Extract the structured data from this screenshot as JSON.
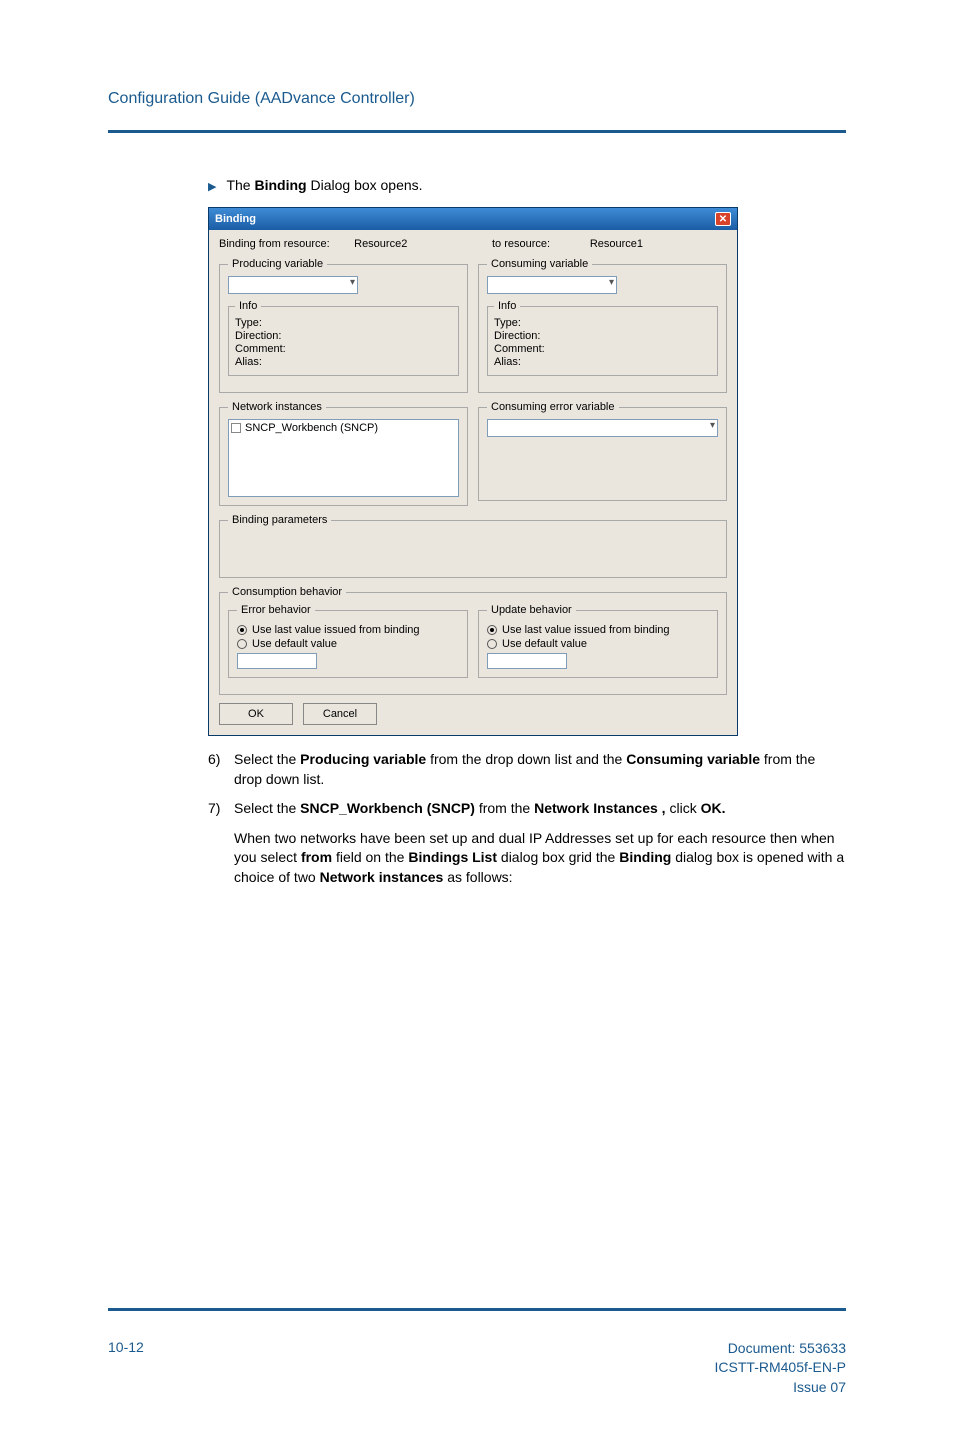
{
  "header": {
    "title": "Configuration Guide (AADvance Controller)"
  },
  "bullet": {
    "prefix": "The ",
    "bold": "Binding",
    "suffix": "  Dialog box opens."
  },
  "dialog": {
    "title": "Binding",
    "top": {
      "fromLabel": "Binding from resource:",
      "fromVal": "Resource2",
      "toLabel": "to resource:",
      "toVal": "Resource1"
    },
    "left": {
      "prodVar": "Producing variable",
      "info": "Info",
      "type": "Type:",
      "direction": "Direction:",
      "comment": "Comment:",
      "alias": "Alias:",
      "netInst": "Network instances",
      "treeItem": "SNCP_Workbench (SNCP)"
    },
    "right": {
      "consVar": "Consuming variable",
      "info": "Info",
      "type": "Type:",
      "direction": "Direction:",
      "comment": "Comment:",
      "alias": "Alias:",
      "consErr": "Consuming error variable"
    },
    "params": "Binding parameters",
    "consumption": {
      "legend": "Consumption behavior",
      "error": {
        "legend": "Error behavior",
        "r1": "Use last value issued from binding",
        "r2": "Use default value"
      },
      "update": {
        "legend": "Update behavior",
        "r1": "Use last value issued from binding",
        "r2": "Use default value"
      }
    },
    "ok": "OK",
    "cancel": "Cancel"
  },
  "steps": {
    "s6": {
      "a": "Select the ",
      "b": "Producing variable",
      "c": " from the drop down list and the ",
      "d": "Consuming variable",
      "e": " from the drop down list."
    },
    "s7": {
      "a": "Select the ",
      "b": "SNCP_Workbench (SNCP)",
      "c": " from the ",
      "d": "Network Instances ,",
      "e": " click ",
      "f": "OK."
    }
  },
  "para": {
    "a": "When two networks have been set up and dual IP Addresses set up for each resource then when you select ",
    "b": "from",
    "c": " field on the ",
    "d": "Bindings List",
    "e": " dialog box grid the ",
    "f": "Binding",
    "g": " dialog box is opened with a choice of two ",
    "h": "Network instances",
    "i": " as follows:"
  },
  "footer": {
    "page": "10-12",
    "doc1": "Document: 553633",
    "doc2": "ICSTT-RM405f-EN-P",
    "doc3": "Issue 07"
  }
}
